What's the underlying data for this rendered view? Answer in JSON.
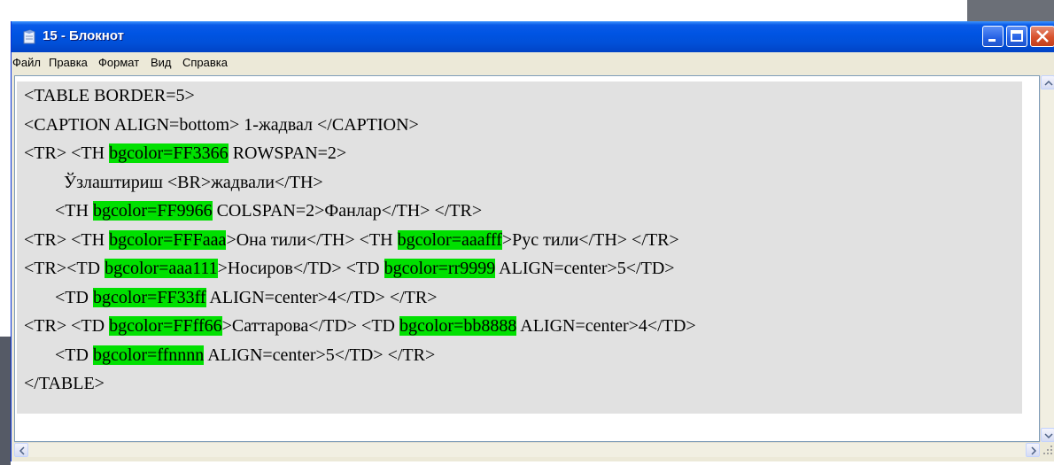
{
  "window": {
    "title": "15 - Блокнот"
  },
  "menu": [
    "Файл",
    "Правка",
    "Формат",
    "Вид",
    "Справка"
  ],
  "code_lines": [
    [
      {
        "t": "<TABLE BORDER=5>"
      }
    ],
    [
      {
        "t": "<CAPTION ALIGN=bottom> 1-жадвал </CAPTION>"
      }
    ],
    [
      {
        "t": "<TR> <TH "
      },
      {
        "t": "bgcolor=FF3366",
        "hl": true
      },
      {
        "t": " ROWSPAN=2>"
      }
    ],
    [
      {
        "t": "         Ўзлаштириш <BR>жадвали</TH>"
      }
    ],
    [
      {
        "t": "       <TH "
      },
      {
        "t": "bgcolor=FF9966",
        "hl": true
      },
      {
        "t": " COLSPAN=2>Фанлар</TH> </TR>"
      }
    ],
    [
      {
        "t": "<TR> <TH "
      },
      {
        "t": "bgcolor=FFFaaa",
        "hl": true
      },
      {
        "t": ">Она тили</TH> <TH "
      },
      {
        "t": "bgcolor=aaafff",
        "hl": true
      },
      {
        "t": ">Рус тили</TH> </TR>"
      }
    ],
    [
      {
        "t": "<TR><TD "
      },
      {
        "t": "bgcolor=aaa111",
        "hl": true
      },
      {
        "t": ">Носиров</TD> <TD "
      },
      {
        "t": "bgcolor=rr9999",
        "hl": true
      },
      {
        "t": " ALIGN=center>5</TD>"
      }
    ],
    [
      {
        "t": "       <TD "
      },
      {
        "t": "bgcolor=FF33ff",
        "hl": true
      },
      {
        "t": " ALIGN=center>4</TD> </TR>"
      }
    ],
    [
      {
        "t": "<TR> <TD "
      },
      {
        "t": "bgcolor=FFff66",
        "hl": true
      },
      {
        "t": ">Саттарова</TD> <TD "
      },
      {
        "t": "bgcolor=bb8888",
        "hl": true
      },
      {
        "t": " ALIGN=center>4</TD>"
      }
    ],
    [
      {
        "t": "       <TD "
      },
      {
        "t": "bgcolor=ffnnnn",
        "hl": true
      },
      {
        "t": " ALIGN=center>5</TD> </TR>"
      }
    ],
    [
      {
        "t": "</TABLE>"
      }
    ]
  ],
  "colors": {
    "titlebar": "#0054E3",
    "highlight": "#00E000",
    "code_background": "#E1E1E1",
    "window_frame": "#ECE9D8"
  },
  "icons": [
    "notepad-icon",
    "minimize-icon",
    "maximize-icon",
    "close-icon",
    "scroll-up-icon",
    "scroll-down-icon",
    "scroll-left-icon",
    "scroll-right-icon",
    "resize-grip-icon"
  ]
}
